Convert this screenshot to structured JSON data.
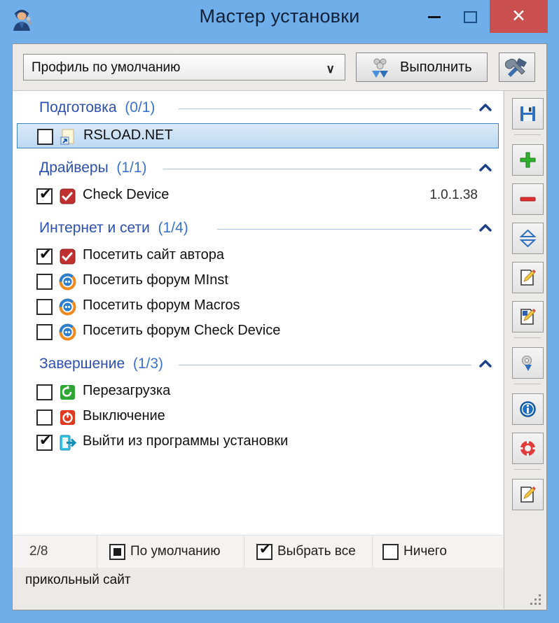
{
  "window": {
    "title": "Мастер установки",
    "icon": "installer-worker-icon",
    "buttons": {
      "minimize": "–",
      "maximize": "□",
      "close": "✕"
    },
    "close_color": "#c9504f",
    "titlebar_color": "#6faee8"
  },
  "toolbar": {
    "profile_value": "Профиль по умолчанию",
    "caret": "∨",
    "execute_label": "Выполнить",
    "tools_label": ""
  },
  "groups": [
    {
      "name": "Подготовка",
      "count": "(0/1)",
      "items": [
        {
          "label": "RSLOAD.NET",
          "checked": false,
          "selected": true,
          "icon": "shortcut-icon",
          "version": ""
        }
      ]
    },
    {
      "name": "Драйверы",
      "count": "(1/1)",
      "items": [
        {
          "label": "Check Device",
          "checked": true,
          "selected": false,
          "icon": "red-check-icon",
          "version": "1.0.1.38"
        }
      ]
    },
    {
      "name": "Интернет и сети",
      "count": "(1/4)",
      "items": [
        {
          "label": "Посетить сайт автора",
          "checked": true,
          "selected": false,
          "icon": "red-check-icon",
          "version": ""
        },
        {
          "label": "Посетить форум MInst",
          "checked": false,
          "selected": false,
          "icon": "forum-ring-icon",
          "version": ""
        },
        {
          "label": "Посетить форум Macros",
          "checked": false,
          "selected": false,
          "icon": "forum-ring-icon",
          "version": ""
        },
        {
          "label": "Посетить форум Check Device",
          "checked": false,
          "selected": false,
          "icon": "forum-ring-icon",
          "version": ""
        }
      ]
    },
    {
      "name": "Завершение",
      "count": "(1/3)",
      "items": [
        {
          "label": "Перезагрузка",
          "checked": false,
          "selected": false,
          "icon": "restart-icon",
          "version": ""
        },
        {
          "label": "Выключение",
          "checked": false,
          "selected": false,
          "icon": "shutdown-icon",
          "version": ""
        },
        {
          "label": "Выйти из программы установки",
          "checked": true,
          "selected": false,
          "icon": "exit-icon",
          "version": ""
        }
      ]
    }
  ],
  "sidebar": {
    "buttons": [
      {
        "icon": "save-icon"
      },
      {
        "icon": "add-icon"
      },
      {
        "icon": "remove-icon"
      },
      {
        "icon": "move-updown-icon"
      },
      {
        "icon": "edit-item-icon"
      },
      {
        "icon": "edit-properties-icon"
      },
      {
        "icon": "settings-icon"
      },
      {
        "icon": "info-icon"
      },
      {
        "icon": "help-icon"
      },
      {
        "icon": "edit-note-icon"
      }
    ]
  },
  "bottom": {
    "counter": "2/8",
    "default_label": "По умолчанию",
    "select_all_label": "Выбрать все",
    "none_label": "Ничего",
    "status": "прикольный сайт"
  }
}
